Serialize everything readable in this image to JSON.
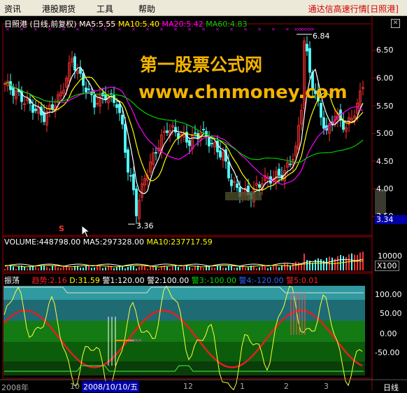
{
  "menu": {
    "items": [
      "资讯",
      "港股期货",
      "工具",
      "帮助"
    ],
    "title": "通达信高速行情[日照港]"
  },
  "price_panel": {
    "header": {
      "name": "日照港",
      "period": "(日线,前复权)",
      "ma5": "MA5:5.55",
      "ma10": "MA10:5.40",
      "ma20": "MA20:5.42",
      "ma60": "MA60:4.83"
    },
    "high_label": "6.84",
    "low_label": "3.36",
    "marker_s": "S",
    "axis_ticks": [
      "6.50",
      "6.00",
      "5.50",
      "5.00",
      "4.50",
      "4.00",
      "3.50"
    ],
    "current_price": "3.34"
  },
  "watermark": {
    "title": "第一股票公式网",
    "url": "www.chnmoney.com"
  },
  "volume_panel": {
    "volume": "VOLUME:448798.00",
    "ma5": "MA5:297328.00",
    "ma10": "MA10:237717.59",
    "axis_tick": "10000",
    "axis_unit": "X100"
  },
  "indicator_panel": {
    "name": "振荡",
    "trend": "趋势:2.16",
    "d": "D:31.59",
    "alert1": "警1:120.00",
    "alert2": "警2:100.00",
    "alert3": "警3:-100.00",
    "alert4": "警4:-120.00",
    "alert5": "警5:0.01",
    "axis_ticks": [
      "100.00",
      "50.00",
      "0.00",
      "-50.00"
    ]
  },
  "date_axis": {
    "labels": [
      "2008年",
      "10",
      "2008/10/10/五",
      "12",
      "1",
      "2",
      "3"
    ],
    "period_label": "日线"
  },
  "colors": {
    "ma5": "#ffffff",
    "ma10": "#ffff00",
    "ma20": "#ff00ff",
    "ma60": "#00cc00",
    "up": "#ff3232",
    "down": "#54ffff",
    "menu_title": "#d40000",
    "watermark": "#f3b300"
  }
}
